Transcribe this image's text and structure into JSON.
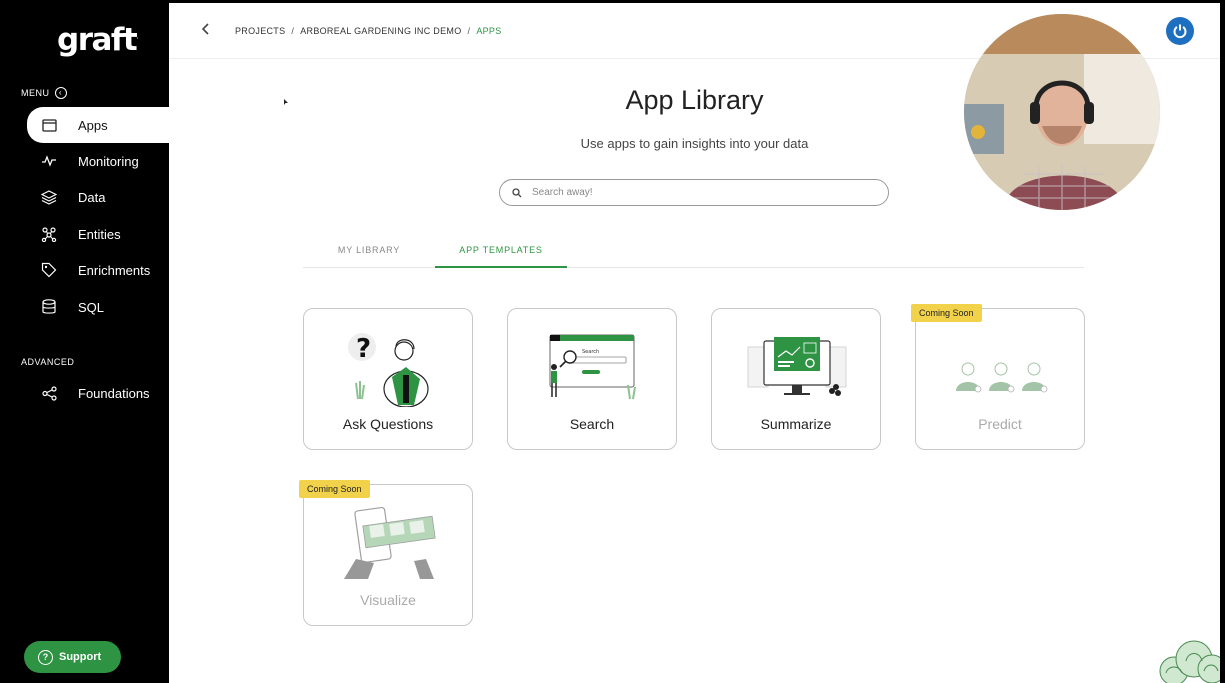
{
  "brand": {
    "logo": "graft",
    "tm": "."
  },
  "sidebar": {
    "menu_label": "MENU",
    "menu_items": [
      {
        "label": "Apps",
        "icon": "window-icon",
        "active": true
      },
      {
        "label": "Monitoring",
        "icon": "activity-icon"
      },
      {
        "label": "Data",
        "icon": "layers-icon"
      },
      {
        "label": "Entities",
        "icon": "graph-icon"
      },
      {
        "label": "Enrichments",
        "icon": "tag-icon"
      },
      {
        "label": "SQL",
        "icon": "database-icon"
      }
    ],
    "advanced_label": "ADVANCED",
    "advanced_items": [
      {
        "label": "Foundations",
        "icon": "share-icon"
      }
    ],
    "support_label": "Support"
  },
  "header": {
    "breadcrumb": [
      "PROJECTS",
      "ARBOREAL GARDENING INC DEMO",
      "APPS"
    ],
    "separator": "/"
  },
  "main": {
    "title": "App Library",
    "subtitle": "Use apps to gain insights into your data",
    "search": {
      "placeholder": "Search away!",
      "value": ""
    },
    "tabs": [
      {
        "label": "MY LIBRARY",
        "active": false
      },
      {
        "label": "APP TEMPLATES",
        "active": true
      }
    ],
    "cards": [
      {
        "label": "Ask Questions",
        "badge": ""
      },
      {
        "label": "Search",
        "badge": ""
      },
      {
        "label": "Summarize",
        "badge": ""
      },
      {
        "label": "Predict",
        "badge": "Coming Soon"
      },
      {
        "label": "Visualize",
        "badge": "Coming Soon"
      }
    ]
  },
  "colors": {
    "accent": "#2e9444",
    "sidebar_bg": "#000000",
    "badge": "#f1d24a",
    "power_button": "#1f6fc1"
  }
}
